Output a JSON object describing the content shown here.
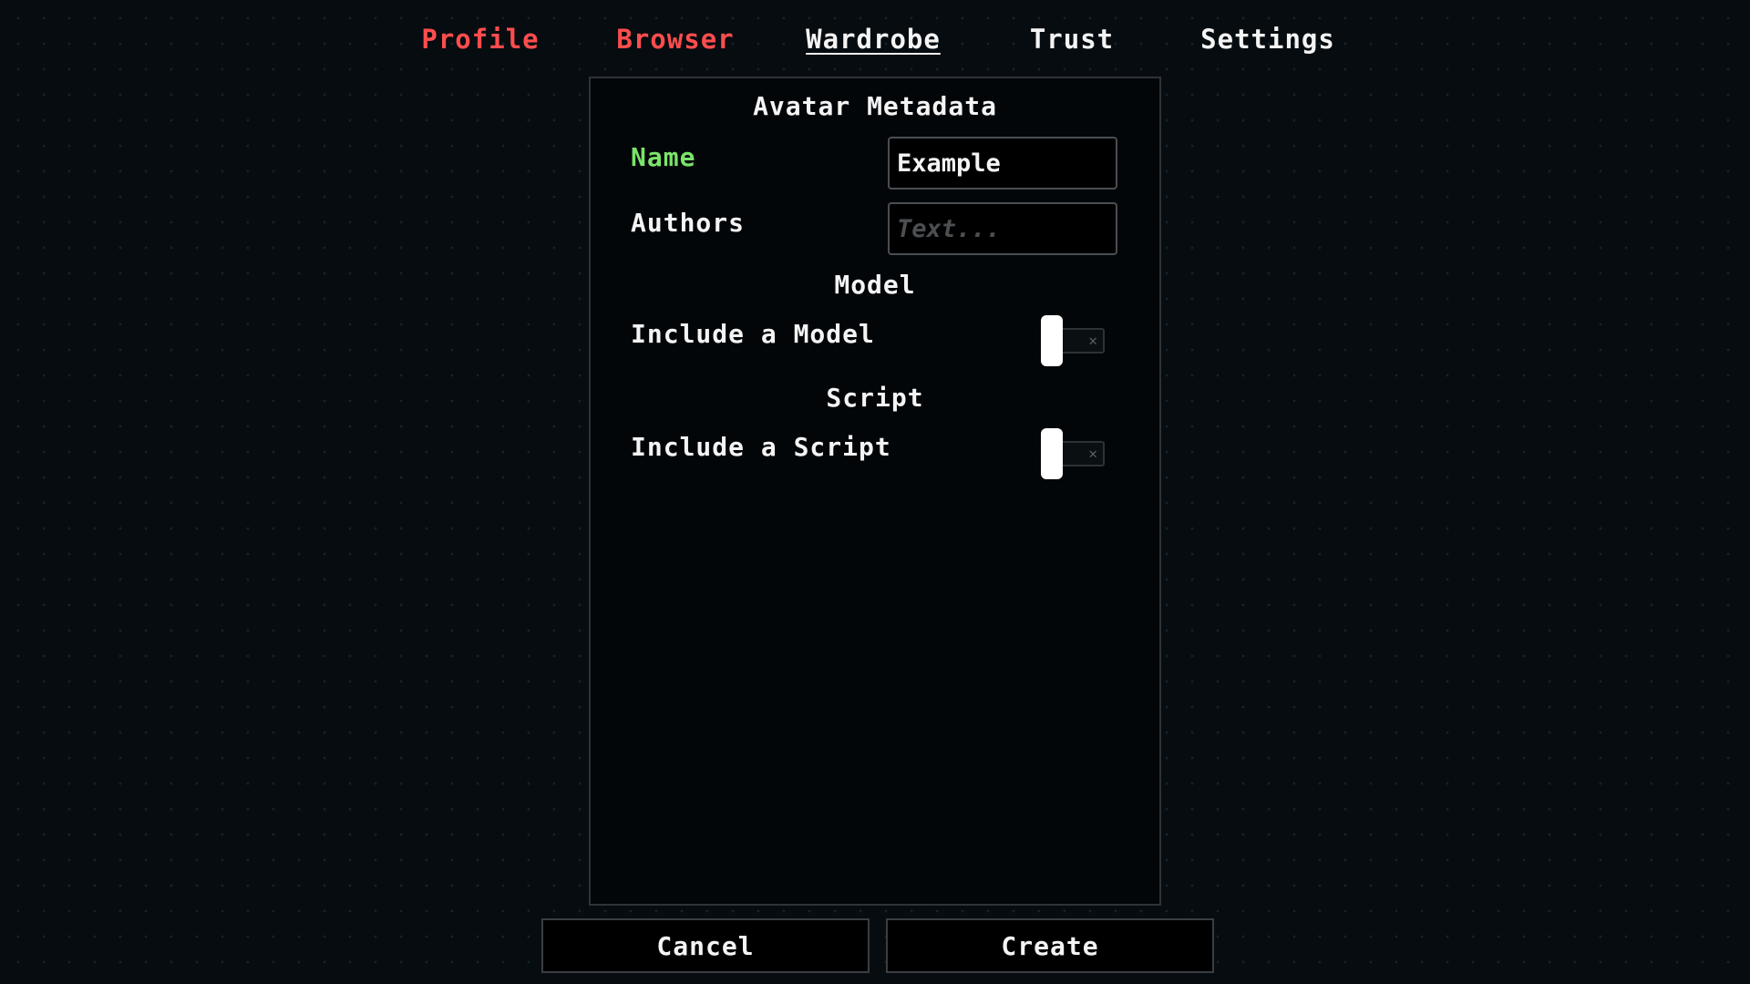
{
  "nav": {
    "tabs": [
      {
        "label": "Profile",
        "color": "#ff4d4d"
      },
      {
        "label": "Browser",
        "color": "#ff4d4d"
      },
      {
        "label": "Wardrobe",
        "active": true
      },
      {
        "label": "Trust"
      },
      {
        "label": "Settings"
      }
    ]
  },
  "panel": {
    "title": "Avatar Metadata",
    "name": {
      "label": "Name",
      "value": "Example",
      "label_color": "#7be36a"
    },
    "authors": {
      "label": "Authors",
      "placeholder": "Text..."
    },
    "model": {
      "heading": "Model",
      "toggle_label": "Include a Model",
      "enabled": false
    },
    "script": {
      "heading": "Script",
      "toggle_label": "Include a Script",
      "enabled": false
    }
  },
  "footer": {
    "cancel_label": "Cancel",
    "create_label": "Create"
  },
  "icons": {
    "toggle_off": "close-icon"
  }
}
